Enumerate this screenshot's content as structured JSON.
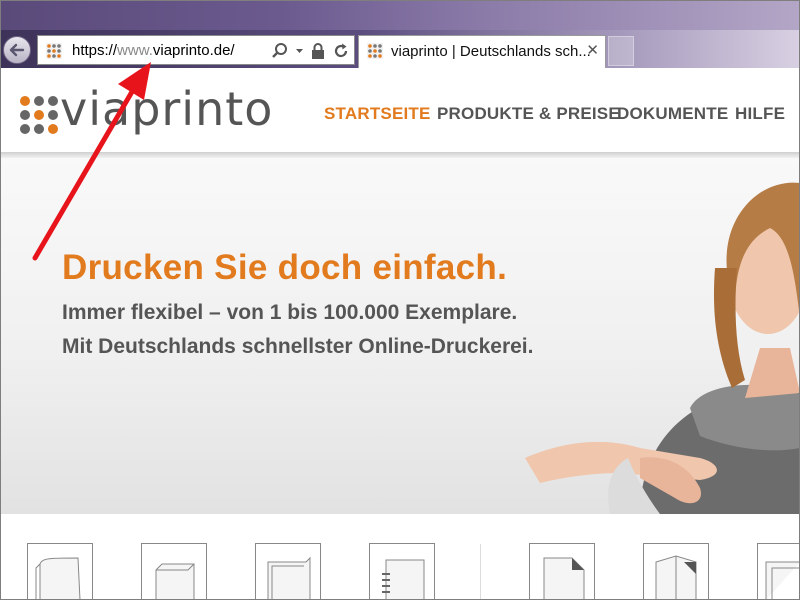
{
  "browser": {
    "address_url_prefix": "https://",
    "address_url_sub": "www.",
    "address_url_domain": "viaprinto.de/",
    "tab_title": "viaprinto | Deutschlands sch...",
    "tab_close": "✕",
    "icons": [
      "back-arrow-icon",
      "site-favicon",
      "search-icon",
      "dropdown-arrow-icon",
      "lock-icon",
      "refresh-icon",
      "close-icon"
    ]
  },
  "site": {
    "logo_text": "viaprinto",
    "nav": [
      {
        "label": "STARTSEITE",
        "active": true
      },
      {
        "label": "PRODUKTE & PREISE",
        "active": false
      },
      {
        "label": "DOKUMENTE",
        "active": false
      },
      {
        "label": "HILFE",
        "active": false
      }
    ],
    "hero": {
      "headline": "Drucken Sie doch einfach.",
      "line1": "Immer flexibel – von 1 bis 100.000 Exemplare.",
      "line2": "Mit Deutschlands schnellster Online-Druckerei."
    },
    "products": [
      "softcover-book-icon",
      "hardcover-book-icon",
      "folder-icon",
      "spiral-binding-icon",
      "document-icon",
      "folded-flyer-icon",
      "stacked-document-icon"
    ]
  },
  "colors": {
    "accent_orange": "#e27a1e",
    "text_gray": "#555555",
    "annotation_red": "#e8141c"
  }
}
